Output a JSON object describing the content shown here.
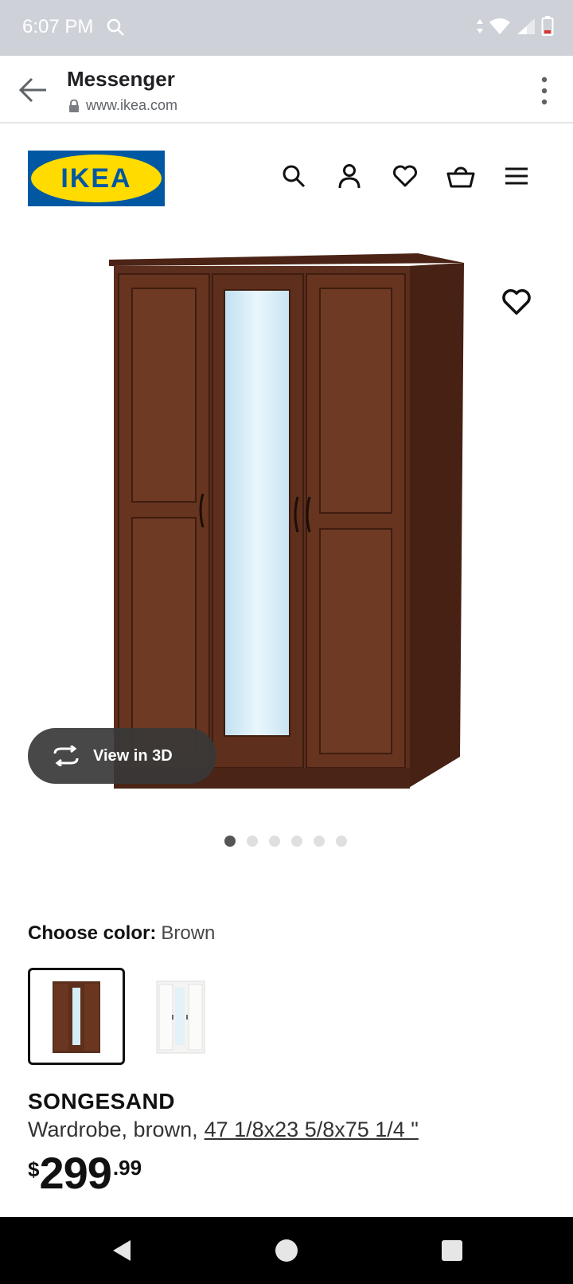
{
  "status_bar": {
    "time": "6:07 PM",
    "icons": [
      "search-icon",
      "data-arrows-icon",
      "wifi-icon",
      "signal-icon",
      "battery-icon"
    ]
  },
  "browser": {
    "title": "Messenger",
    "url": "www.ikea.com",
    "icons": [
      "back-arrow-icon",
      "lock-icon",
      "overflow-menu-icon"
    ]
  },
  "header": {
    "logo_text": "IKEA",
    "icons": [
      "search-icon",
      "account-icon",
      "heart-icon",
      "cart-icon",
      "menu-icon"
    ]
  },
  "gallery": {
    "view3d_label": "View in 3D",
    "dots_count": 6,
    "active_dot": 0
  },
  "color_picker": {
    "label": "Choose color:",
    "value": "Brown",
    "options": [
      "Brown",
      "White"
    ]
  },
  "product": {
    "name": "SONGESAND",
    "description": "Wardrobe, brown,",
    "dimensions": "47 1/8x23 5/8x75 1/4 \"",
    "price_currency": "$",
    "price_integer": "299",
    "price_decimal": ".99"
  },
  "colors": {
    "ikea_blue": "#0058a3",
    "ikea_yellow": "#ffdb00",
    "wood": "#5a2d1c"
  }
}
